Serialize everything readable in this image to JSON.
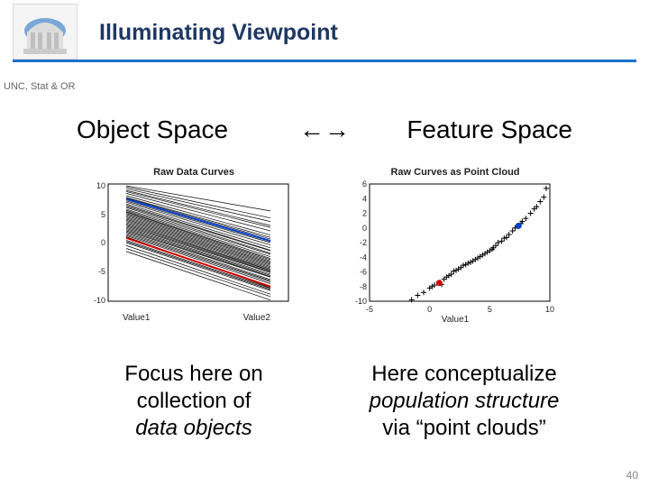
{
  "slide": {
    "title": "Illuminating Viewpoint",
    "dept": "UNC, Stat & OR",
    "number": "40"
  },
  "headings": {
    "left": "Object Space",
    "arrows": "←→",
    "right": "Feature Space"
  },
  "chart_titles": {
    "left": "Raw Data Curves",
    "right": "Raw Curves as Point Cloud"
  },
  "axis_labels": {
    "left_x1": "Value1",
    "left_x2": "Value2",
    "right_x": "Value1"
  },
  "captions": {
    "left_l1": "Focus here on",
    "left_l2": "collection of",
    "left_l3": "data objects",
    "right_l1": "Here conceptualize",
    "right_l2": "population structure",
    "right_l3": "via “point clouds”"
  },
  "chart_data": [
    {
      "type": "line",
      "title": "Raw Data Curves",
      "x": [
        "Value1",
        "Value2"
      ],
      "ylim": [
        -10,
        10
      ],
      "yticks": [
        -10,
        -5,
        0,
        5,
        10
      ],
      "series": [
        {
          "name": "curve",
          "values": [
            9.7,
            5.4
          ]
        },
        {
          "name": "curve",
          "values": [
            9.5,
            4.2
          ]
        },
        {
          "name": "curve",
          "values": [
            9.2,
            3.6
          ]
        },
        {
          "name": "curve",
          "values": [
            8.9,
            2.9
          ]
        },
        {
          "name": "curve",
          "values": [
            8.7,
            2.6
          ]
        },
        {
          "name": "curve",
          "values": [
            8.4,
            2.0
          ]
        },
        {
          "name": "curve",
          "values": [
            8.0,
            1.3
          ]
        },
        {
          "name": "curve",
          "values": [
            7.7,
            0.9
          ]
        },
        {
          "name": "curve",
          "values": [
            7.6,
            0.6
          ]
        },
        {
          "name": "curve",
          "values": [
            7.3,
            0.2
          ]
        },
        {
          "name": "curve",
          "values": [
            7.1,
            0.0
          ]
        },
        {
          "name": "curve",
          "values": [
            6.9,
            -0.4
          ]
        },
        {
          "name": "curve",
          "values": [
            6.6,
            -0.9
          ]
        },
        {
          "name": "curve",
          "values": [
            6.4,
            -1.3
          ]
        },
        {
          "name": "curve",
          "values": [
            6.2,
            -1.4
          ]
        },
        {
          "name": "curve",
          "values": [
            6.0,
            -1.8
          ]
        },
        {
          "name": "curve",
          "values": [
            5.7,
            -2.0
          ]
        },
        {
          "name": "curve",
          "values": [
            5.5,
            -2.4
          ]
        },
        {
          "name": "curve",
          "values": [
            5.3,
            -2.7
          ]
        },
        {
          "name": "curve",
          "values": [
            5.2,
            -2.9
          ]
        },
        {
          "name": "curve",
          "values": [
            5.0,
            -3.1
          ]
        },
        {
          "name": "curve",
          "values": [
            4.8,
            -3.3
          ]
        },
        {
          "name": "curve",
          "values": [
            4.6,
            -3.5
          ]
        },
        {
          "name": "curve",
          "values": [
            4.4,
            -3.7
          ]
        },
        {
          "name": "curve",
          "values": [
            4.2,
            -3.9
          ]
        },
        {
          "name": "curve",
          "values": [
            4.0,
            -4.1
          ]
        },
        {
          "name": "curve",
          "values": [
            3.8,
            -4.3
          ]
        },
        {
          "name": "curve",
          "values": [
            3.6,
            -4.5
          ]
        },
        {
          "name": "curve",
          "values": [
            3.4,
            -4.7
          ]
        },
        {
          "name": "curve",
          "values": [
            3.2,
            -4.8
          ]
        },
        {
          "name": "curve",
          "values": [
            3.0,
            -5.0
          ]
        },
        {
          "name": "curve",
          "values": [
            2.8,
            -5.1
          ]
        },
        {
          "name": "curve",
          "values": [
            2.6,
            -5.4
          ]
        },
        {
          "name": "curve",
          "values": [
            2.4,
            -5.6
          ]
        },
        {
          "name": "curve",
          "values": [
            2.2,
            -5.8
          ]
        },
        {
          "name": "curve",
          "values": [
            2.0,
            -5.9
          ]
        },
        {
          "name": "curve",
          "values": [
            1.8,
            -6.3
          ]
        },
        {
          "name": "curve",
          "values": [
            1.6,
            -6.5
          ]
        },
        {
          "name": "curve",
          "values": [
            1.4,
            -6.7
          ]
        },
        {
          "name": "curve",
          "values": [
            1.2,
            -7.0
          ]
        },
        {
          "name": "curve",
          "values": [
            1.0,
            -7.7
          ]
        },
        {
          "name": "curve",
          "values": [
            0.4,
            -7.8
          ]
        },
        {
          "name": "curve",
          "values": [
            0.2,
            -8.0
          ]
        },
        {
          "name": "curve",
          "values": [
            0.0,
            -8.2
          ]
        },
        {
          "name": "curve",
          "values": [
            -0.5,
            -8.8
          ]
        },
        {
          "name": "curve",
          "values": [
            -1.0,
            -9.2
          ]
        },
        {
          "name": "curve",
          "values": [
            -1.5,
            -9.8
          ]
        },
        {
          "name": "highlight-red",
          "values": [
            0.8,
            -7.5
          ]
        },
        {
          "name": "highlight-blue",
          "values": [
            7.4,
            0.3
          ]
        }
      ]
    },
    {
      "type": "scatter",
      "title": "Raw Curves as Point Cloud",
      "xlabel": "Value1",
      "xlim": [
        -5,
        10
      ],
      "ylim": [
        -10,
        6
      ],
      "xticks": [
        -5,
        0,
        5,
        10
      ],
      "yticks": [
        -10,
        -8,
        -6,
        -4,
        -2,
        0,
        2,
        4,
        6
      ],
      "series": [
        {
          "name": "curves",
          "marker": "+",
          "points": [
            [
              -1.5,
              -9.8
            ],
            [
              -1.0,
              -9.2
            ],
            [
              -0.5,
              -8.8
            ],
            [
              0.0,
              -8.2
            ],
            [
              0.2,
              -8.0
            ],
            [
              0.4,
              -7.8
            ],
            [
              1.0,
              -7.7
            ],
            [
              1.2,
              -7.0
            ],
            [
              1.4,
              -6.7
            ],
            [
              1.6,
              -6.5
            ],
            [
              1.8,
              -6.3
            ],
            [
              2.0,
              -5.9
            ],
            [
              2.2,
              -5.8
            ],
            [
              2.4,
              -5.6
            ],
            [
              2.6,
              -5.4
            ],
            [
              2.8,
              -5.1
            ],
            [
              3.0,
              -5.0
            ],
            [
              3.2,
              -4.8
            ],
            [
              3.4,
              -4.7
            ],
            [
              3.6,
              -4.5
            ],
            [
              3.8,
              -4.3
            ],
            [
              4.0,
              -4.1
            ],
            [
              4.2,
              -3.9
            ],
            [
              4.4,
              -3.7
            ],
            [
              4.6,
              -3.5
            ],
            [
              4.8,
              -3.3
            ],
            [
              5.0,
              -3.1
            ],
            [
              5.2,
              -2.9
            ],
            [
              5.3,
              -2.7
            ],
            [
              5.5,
              -2.4
            ],
            [
              5.7,
              -2.0
            ],
            [
              6.0,
              -1.8
            ],
            [
              6.2,
              -1.4
            ],
            [
              6.4,
              -1.3
            ],
            [
              6.6,
              -0.9
            ],
            [
              6.9,
              -0.4
            ],
            [
              7.1,
              0.0
            ],
            [
              7.3,
              0.2
            ],
            [
              7.6,
              0.6
            ],
            [
              7.7,
              0.9
            ],
            [
              8.0,
              1.3
            ],
            [
              8.4,
              2.0
            ],
            [
              8.7,
              2.6
            ],
            [
              8.9,
              2.9
            ],
            [
              9.2,
              3.6
            ],
            [
              9.5,
              4.2
            ],
            [
              9.7,
              5.4
            ]
          ]
        },
        {
          "name": "highlight-red",
          "marker": "o",
          "color": "#d00000",
          "points": [
            [
              0.8,
              -7.5
            ]
          ]
        },
        {
          "name": "highlight-blue",
          "marker": "o",
          "color": "#0040d0",
          "points": [
            [
              7.4,
              0.3
            ]
          ]
        }
      ]
    }
  ]
}
